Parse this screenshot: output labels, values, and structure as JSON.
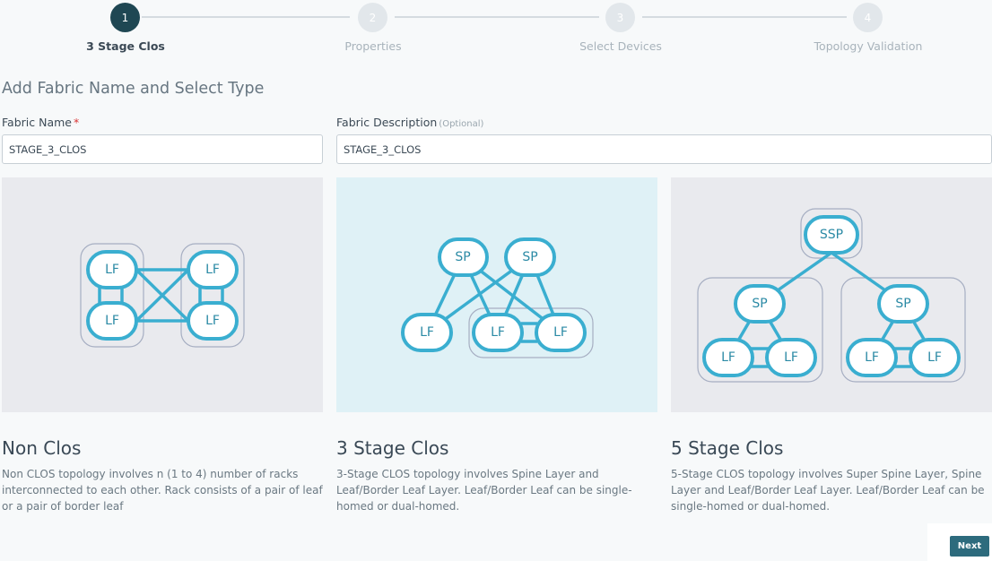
{
  "stepper": {
    "steps": [
      {
        "number": "1",
        "label": "3 Stage Clos",
        "active": true
      },
      {
        "number": "2",
        "label": "Properties",
        "active": false
      },
      {
        "number": "3",
        "label": "Select Devices",
        "active": false
      },
      {
        "number": "4",
        "label": "Topology Validation",
        "active": false
      }
    ]
  },
  "form": {
    "section_title": "Add Fabric Name and Select Type",
    "fabric_name": {
      "label": "Fabric Name",
      "required_mark": "*",
      "value": "STAGE_3_CLOS"
    },
    "fabric_description": {
      "label": "Fabric Description",
      "optional_mark": "(Optional)",
      "value": "STAGE_3_CLOS"
    }
  },
  "types": [
    {
      "title": "Non Clos",
      "description": "Non CLOS topology involves n (1 to 4) number of racks interconnected to each other. Rack consists of a pair of leaf or a pair of border leaf",
      "selected": false,
      "node_labels": [
        "LF",
        "LF",
        "LF",
        "LF"
      ]
    },
    {
      "title": "3 Stage Clos",
      "description": "3-Stage CLOS topology involves Spine Layer and Leaf/Border Leaf Layer. Leaf/Border Leaf can be single-homed or dual-homed.",
      "selected": true,
      "node_labels": [
        "SP",
        "SP",
        "LF",
        "LF",
        "LF"
      ]
    },
    {
      "title": "5 Stage Clos",
      "description": "5-Stage CLOS topology involves Super Spine Layer, Spine Layer and Leaf/Border Leaf Layer. Leaf/Border Leaf can be single-homed or dual-homed.",
      "selected": false,
      "node_labels": [
        "SSP",
        "SP",
        "SP",
        "LF",
        "LF",
        "LF",
        "LF"
      ]
    }
  ],
  "footer": {
    "next_label": "Next"
  },
  "colors": {
    "accent": "#2d6b7d",
    "step_active": "#1f4753",
    "node_stroke": "#3aaed0",
    "selected_bg": "#dff1f6"
  }
}
